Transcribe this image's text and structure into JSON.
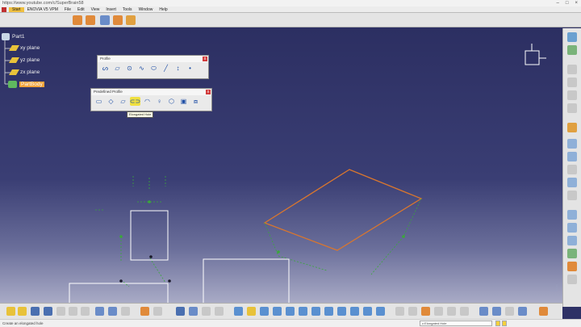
{
  "browser": {
    "url": "https://www.youtube.com/c/SuperBrain58",
    "controls": [
      "–",
      "□",
      "×"
    ]
  },
  "menu": {
    "start": "Start",
    "items": [
      "ENOVIA V5 VPM",
      "File",
      "Edit",
      "View",
      "Insert",
      "Tools",
      "Window",
      "Help"
    ]
  },
  "tree": {
    "root": "Part1",
    "children": [
      "xy plane",
      "yz plane",
      "zx plane"
    ],
    "body": "PartBody"
  },
  "profile_toolbar": {
    "title": "Profile",
    "close": "x",
    "buttons": [
      {
        "name": "profile-icon",
        "glyph": "ᔕ"
      },
      {
        "name": "predefined-profile-icon",
        "glyph": "▱"
      },
      {
        "name": "circle-icon",
        "glyph": "⊙"
      },
      {
        "name": "spline-icon",
        "glyph": "∿"
      },
      {
        "name": "ellipse-icon",
        "glyph": "⬭"
      },
      {
        "name": "line-icon",
        "glyph": "╱"
      },
      {
        "name": "axis-icon",
        "glyph": "↕"
      },
      {
        "name": "point-icon",
        "glyph": "•"
      }
    ]
  },
  "predefined_toolbar": {
    "title": "Predefined Profile",
    "close": "x",
    "buttons": [
      {
        "name": "rectangle-icon",
        "glyph": "▭"
      },
      {
        "name": "oriented-rectangle-icon",
        "glyph": "◇"
      },
      {
        "name": "parallelogram-icon",
        "glyph": "▱"
      },
      {
        "name": "elongated-hole-icon",
        "glyph": "⊂⊃"
      },
      {
        "name": "cylindrical-elongated-hole-icon",
        "glyph": "◠"
      },
      {
        "name": "keyhole-profile-icon",
        "glyph": "♀"
      },
      {
        "name": "hexagon-icon",
        "glyph": "⬡"
      },
      {
        "name": "centered-rectangle-icon",
        "glyph": "▣"
      },
      {
        "name": "centered-parallelogram-icon",
        "glyph": "⧈"
      }
    ],
    "tooltip": "Elongated Hole"
  },
  "status": {
    "message": "Create an elongated hole",
    "command_field": "c:Elongated Hole"
  },
  "colors": {
    "viewport_top": "#2c2f62",
    "viewport_bottom": "#a9abc6",
    "sketch_white": "#ffffff",
    "sketch_green": "#3aa83a",
    "highlight_orange": "#d8762f",
    "selection_orange": "#f2a33a"
  }
}
